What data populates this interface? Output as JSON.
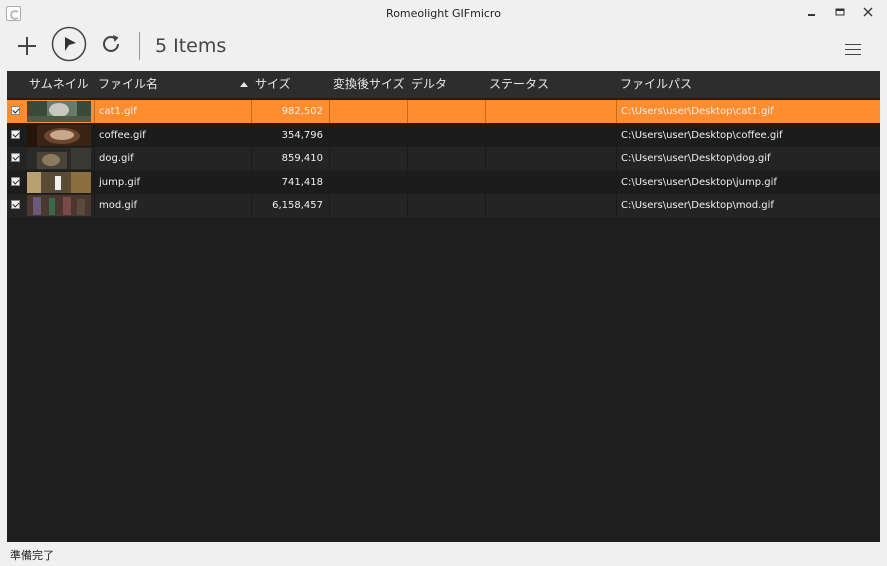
{
  "window": {
    "title": "Romeolight GIFmicro",
    "minimize_icon": "minimize-icon",
    "maximize_icon": "maximize-icon",
    "close_icon": "close-icon"
  },
  "toolbar": {
    "add_icon": "plus-icon",
    "play_icon": "play-icon",
    "refresh_icon": "refresh-icon",
    "items_label": "5 Items",
    "menu_icon": "hamburger-menu-icon"
  },
  "table": {
    "columns": [
      "サムネイル",
      "ファイル名",
      "サイズ",
      "変換後サイズ",
      "デルタ",
      "ステータス",
      "ファイルパス"
    ],
    "sort_column": "サイズ",
    "sort_direction": "ascending",
    "rows": [
      {
        "checked": true,
        "name": "cat1.gif",
        "size": "982,502",
        "converted": "",
        "delta": "",
        "status": "",
        "path": "C:\\Users\\user\\Desktop\\cat1.gif",
        "selected": true,
        "thumb": "cat"
      },
      {
        "checked": true,
        "name": "coffee.gif",
        "size": "354,796",
        "converted": "",
        "delta": "",
        "status": "",
        "path": "C:\\Users\\user\\Desktop\\coffee.gif",
        "selected": false,
        "thumb": "coffee"
      },
      {
        "checked": true,
        "name": "dog.gif",
        "size": "859,410",
        "converted": "",
        "delta": "",
        "status": "",
        "path": "C:\\Users\\user\\Desktop\\dog.gif",
        "selected": false,
        "thumb": "dog"
      },
      {
        "checked": true,
        "name": "jump.gif",
        "size": "741,418",
        "converted": "",
        "delta": "",
        "status": "",
        "path": "C:\\Users\\user\\Desktop\\jump.gif",
        "selected": false,
        "thumb": "jump"
      },
      {
        "checked": true,
        "name": "mod.gif",
        "size": "6,158,457",
        "converted": "",
        "delta": "",
        "status": "",
        "path": "C:\\Users\\user\\Desktop\\mod.gif",
        "selected": false,
        "thumb": "mod"
      }
    ]
  },
  "colors": {
    "selection": "#ff8c2e",
    "grid_background": "#1e1e1f",
    "row_even": "#242425",
    "row_odd": "#1c1c1d",
    "header_background": "#2d2d2e"
  },
  "statusbar": {
    "text": "準備完了"
  }
}
